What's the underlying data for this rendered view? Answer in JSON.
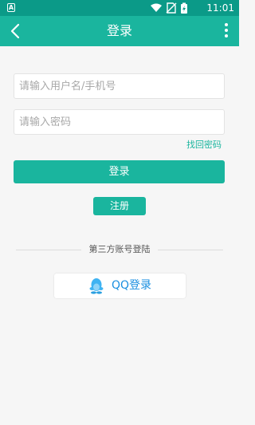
{
  "status_bar": {
    "notification_letter": "A",
    "time": "11:01"
  },
  "app_bar": {
    "title": "登录"
  },
  "form": {
    "username_placeholder": "请输入用户名/手机号",
    "password_placeholder": "请输入密码",
    "forgot_password": "找回密码",
    "login_label": "登录",
    "register_label": "注册"
  },
  "third_party": {
    "label": "第三方账号登陆",
    "qq_label": "QQ登录"
  },
  "colors": {
    "primary": "#1ab59e",
    "status_bar": "#0b9a88",
    "qq_blue": "#1a8fe0",
    "background": "#f6f6f6"
  },
  "icons": {
    "back": "chevron-left-icon",
    "more": "more-vertical-icon",
    "qq": "qq-penguin-icon",
    "wifi": "wifi-icon",
    "no_sim": "no-sim-icon",
    "battery": "battery-charging-icon"
  }
}
